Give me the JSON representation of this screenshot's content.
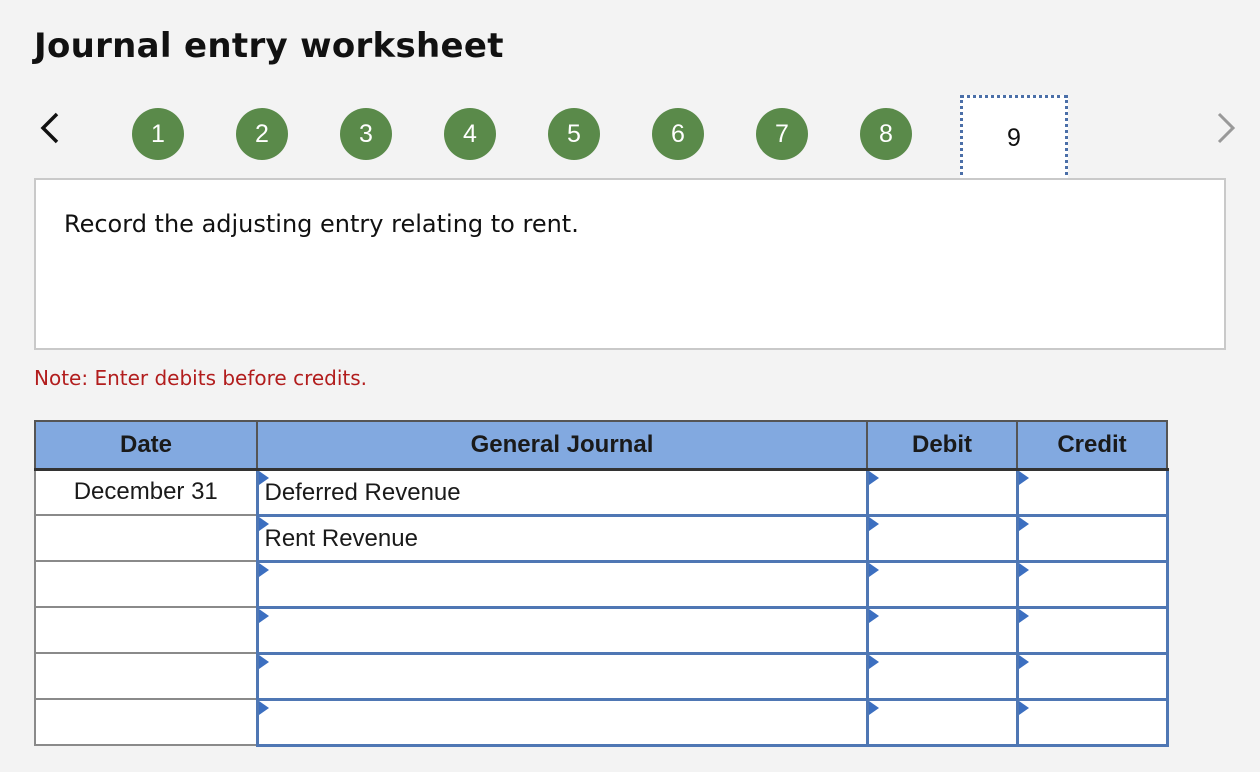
{
  "title": "Journal entry worksheet",
  "nav": {
    "steps": [
      "1",
      "2",
      "3",
      "4",
      "5",
      "6",
      "7",
      "8"
    ],
    "current_step": "9",
    "prev_icon": "chevron-left-icon",
    "next_icon": "chevron-right-icon"
  },
  "prompt": "Record the adjusting entry relating to rent.",
  "note": "Note: Enter debits before credits.",
  "journal": {
    "headers": {
      "date": "Date",
      "general_journal": "General Journal",
      "debit": "Debit",
      "credit": "Credit"
    },
    "rows": [
      {
        "date": "December 31",
        "account": "Deferred Revenue",
        "debit": "",
        "credit": ""
      },
      {
        "date": "",
        "account": "Rent Revenue",
        "debit": "",
        "credit": ""
      },
      {
        "date": "",
        "account": "",
        "debit": "",
        "credit": ""
      },
      {
        "date": "",
        "account": "",
        "debit": "",
        "credit": ""
      },
      {
        "date": "",
        "account": "",
        "debit": "",
        "credit": ""
      },
      {
        "date": "",
        "account": "",
        "debit": "",
        "credit": ""
      }
    ]
  },
  "colors": {
    "step_green": "#5a8a4a",
    "header_blue": "#82a9e0",
    "input_border": "#4f77b4",
    "note_red": "#b21d1d"
  }
}
